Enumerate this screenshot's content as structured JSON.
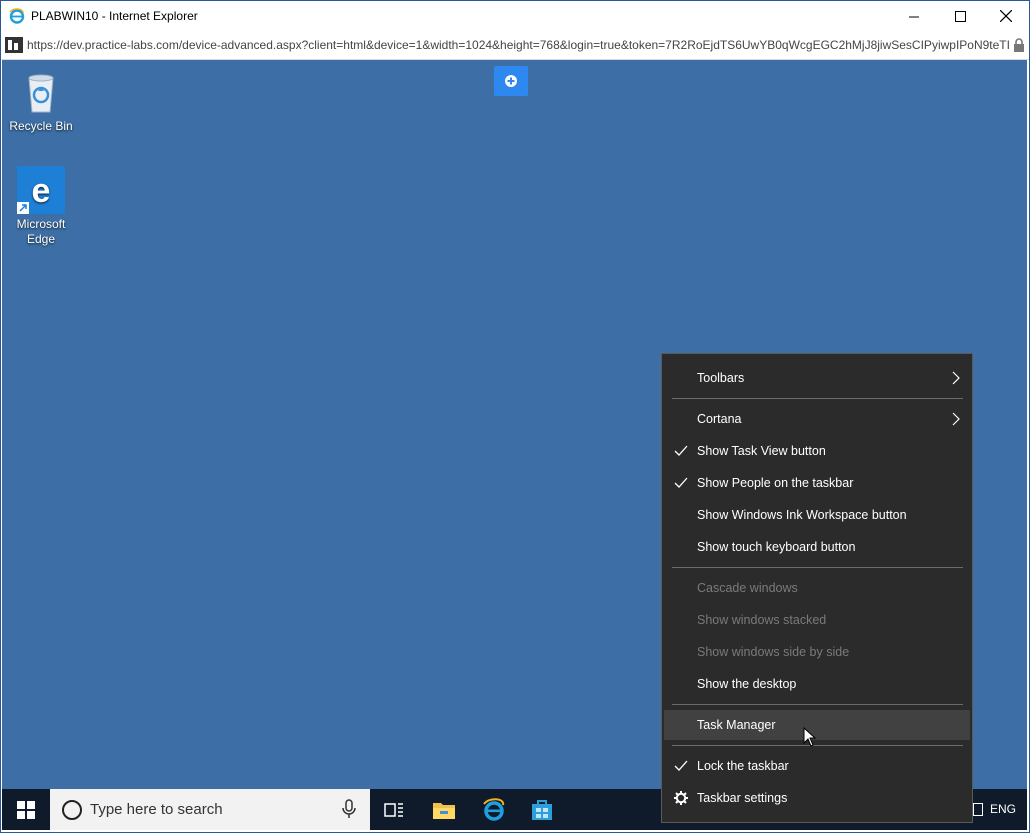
{
  "window": {
    "title": "PLABWIN10 - Internet Explorer",
    "url": "https://dev.practice-labs.com/device-advanced.aspx?client=html&device=1&width=1024&height=768&login=true&token=7R2RoEjdTS6UwYB0qWcgEGC2hMjJ8jiwSesCIPyiwpIPoN9teTI",
    "controls": {
      "minimize": "minimize",
      "maximize": "maximize",
      "close": "close"
    }
  },
  "desktop": {
    "background_color": "#3d6fa6",
    "icons": [
      {
        "label": "Recycle Bin",
        "icon": "recycle-bin-icon"
      },
      {
        "label": "Microsoft Edge",
        "icon": "edge-icon"
      }
    ]
  },
  "taskbar": {
    "search_placeholder": "Type here to search",
    "pinned": [
      "task-view-icon",
      "file-explorer-icon",
      "internet-explorer-icon",
      "store-icon"
    ],
    "tray_language": "ENG"
  },
  "context_menu": {
    "items": [
      {
        "label": "Toolbars",
        "checked": false,
        "submenu": true,
        "enabled": true
      },
      {
        "label": "Cortana",
        "checked": false,
        "submenu": true,
        "enabled": true
      },
      {
        "label": "Show Task View button",
        "checked": true,
        "enabled": true
      },
      {
        "label": "Show People on the taskbar",
        "checked": true,
        "enabled": true
      },
      {
        "label": "Show Windows Ink Workspace button",
        "checked": false,
        "enabled": true
      },
      {
        "label": "Show touch keyboard button",
        "checked": false,
        "enabled": true
      },
      {
        "label": "Cascade windows",
        "enabled": false
      },
      {
        "label": "Show windows stacked",
        "enabled": false
      },
      {
        "label": "Show windows side by side",
        "enabled": false
      },
      {
        "label": "Show the desktop",
        "enabled": true
      },
      {
        "label": "Task Manager",
        "enabled": true,
        "hovered": true
      },
      {
        "label": "Lock the taskbar",
        "checked": true,
        "enabled": true
      },
      {
        "label": "Taskbar settings",
        "enabled": true,
        "icon": "gear-icon"
      }
    ]
  },
  "colors": {
    "menu_bg": "#2b2b2b",
    "menu_hover": "#414141",
    "taskbar_bg": "#0f1b2a",
    "accent": "#2d89ef"
  }
}
